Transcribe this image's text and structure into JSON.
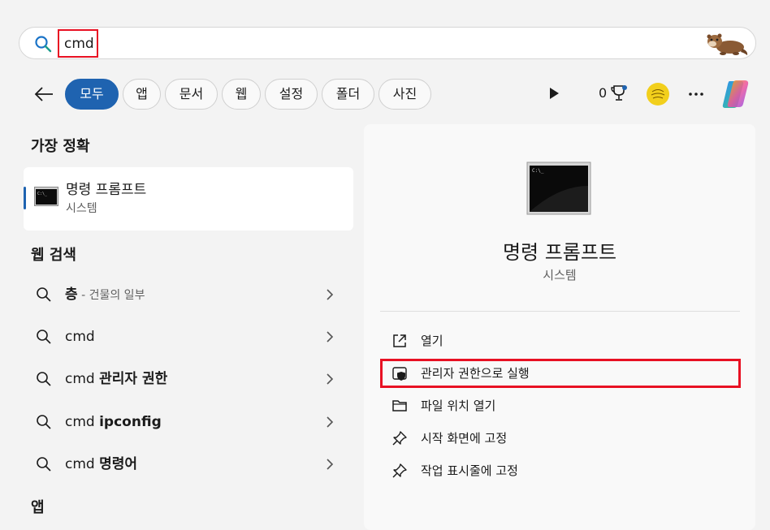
{
  "search": {
    "query": "cmd"
  },
  "filters": [
    {
      "label": "모두",
      "active": true
    },
    {
      "label": "앱",
      "active": false
    },
    {
      "label": "문서",
      "active": false
    },
    {
      "label": "웹",
      "active": false
    },
    {
      "label": "설정",
      "active": false
    },
    {
      "label": "폴더",
      "active": false
    },
    {
      "label": "사진",
      "active": false
    }
  ],
  "toolbar": {
    "points": "0",
    "icons": [
      "play-icon",
      "trophy-icon",
      "rewards-badge",
      "more-icon",
      "copilot-icon"
    ]
  },
  "best_match": {
    "heading": "가장 정확",
    "title": "명령 프롬프트",
    "subtitle": "시스템",
    "icon": "command-prompt-icon"
  },
  "web_search": {
    "heading": "웹 검색",
    "items": [
      {
        "prefix": "",
        "bold": "층",
        "hint": " - 건물의 일부"
      },
      {
        "prefix": "cmd",
        "bold": "",
        "hint": ""
      },
      {
        "prefix": "cmd ",
        "bold": "관리자 권한",
        "hint": ""
      },
      {
        "prefix": "cmd ",
        "bold": "ipconfig",
        "hint": ""
      },
      {
        "prefix": "cmd ",
        "bold": "명령어",
        "hint": ""
      }
    ]
  },
  "apps_heading": "앱",
  "detail": {
    "title": "명령 프롬프트",
    "subtitle": "시스템",
    "actions": [
      {
        "label": "열기",
        "icon": "open-external-icon"
      },
      {
        "label": "관리자 권한으로 실행",
        "icon": "shield-icon",
        "highlighted": true
      },
      {
        "label": "파일 위치 열기",
        "icon": "folder-icon"
      },
      {
        "label": "시작 화면에 고정",
        "icon": "pin-icon"
      },
      {
        "label": "작업 표시줄에 고정",
        "icon": "pin-icon"
      }
    ]
  },
  "colors": {
    "accent": "#1f63b0",
    "highlight": "#e81123",
    "background": "#f3f3f3"
  }
}
